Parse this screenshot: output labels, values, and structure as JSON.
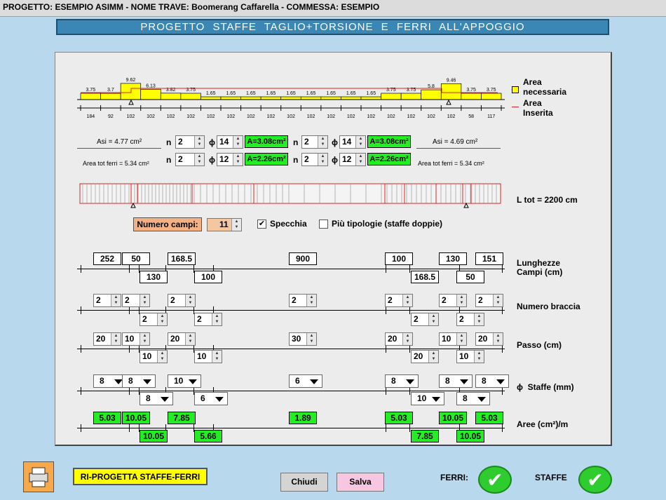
{
  "title": "PROGETTO: ESEMPIO ASIMM - NOME TRAVE: Boomerang Caffarella - COMMESSA: ESEMPIO",
  "banner": "PROGETTO   STAFFE   TAGLIO+TORSIONE   E   FERRI  ALL'APPOGGIO",
  "diagram": {
    "top_values": [
      "3.75",
      "3.7",
      "9.62",
      "6.13",
      "3.82",
      "3.75",
      "1.65",
      "1.65",
      "1.65",
      "1.65",
      "1.65",
      "1.65",
      "1.65",
      "1.65",
      "1.65",
      "3.75",
      "3.75",
      "5.8",
      "9.46",
      "3.75",
      "3.75"
    ],
    "bottom_values": [
      "184",
      "92",
      "102",
      "102",
      "102",
      "102",
      "102",
      "102",
      "102",
      "102",
      "102",
      "102",
      "102",
      "102",
      "102",
      "102",
      "102",
      "102",
      "102",
      "58",
      "117"
    ],
    "legend_area_nec": "Area necessaria",
    "legend_area_ins": "Area Inserita"
  },
  "rebar": {
    "asi_left": "Asi =  4.77 cm²",
    "asi_right": "Asi =  4.69 cm²",
    "tot_left": "Area tot ferri = 5.34 cm²",
    "tot_right": "Area tot ferri = 5.34 cm²",
    "n_label": "n",
    "phi": "ϕ",
    "row1": {
      "n1": "2",
      "d1": "14",
      "a1": "A=3.08cm²",
      "n2": "2",
      "d2": "14",
      "a2": "A=3.08cm²"
    },
    "row2": {
      "n1": "2",
      "d1": "12",
      "a1": "A=2.26cm²",
      "n2": "2",
      "d2": "12",
      "a2": "A=2.26cm²"
    }
  },
  "ltot": "L tot =  2200 cm",
  "numero_campi_label": "Numero campi:",
  "numero_campi": "11",
  "specchia": "Specchia",
  "specchia_mark": "✔",
  "piu_tipologie": "Più tipologie (staffe doppie)",
  "lunghezze": {
    "label": "Lunghezze Campi (cm)",
    "top": [
      "252",
      "50",
      "168.5",
      "900",
      "100",
      "130",
      "151"
    ],
    "bottom": [
      "130",
      "100",
      "168.5",
      "50"
    ]
  },
  "braccia": {
    "label": "Numero braccia",
    "top": [
      "2",
      "2",
      "2",
      "2",
      "2",
      "2",
      "2"
    ],
    "bottom": [
      "2",
      "2",
      "2",
      "2"
    ]
  },
  "passo": {
    "label": "Passo  (cm)",
    "top": [
      "20",
      "10",
      "20",
      "30",
      "20",
      "10",
      "20"
    ],
    "bottom": [
      "10",
      "10",
      "20",
      "10"
    ]
  },
  "staffe": {
    "label": "Staffe  (mm)",
    "top": [
      "8",
      "8",
      "10",
      "6",
      "8",
      "8",
      "8"
    ],
    "bottom": [
      "8",
      "6",
      "10",
      "8"
    ]
  },
  "aree": {
    "label": "Aree  (cm²)/m",
    "top": [
      "5.03",
      "10.05",
      "7.85",
      "1.89",
      "5.03",
      "10.05",
      "5.03"
    ],
    "bottom": [
      "10.05",
      "5.66",
      "7.85",
      "10.05"
    ]
  },
  "buttons": {
    "riprogetta": "RI-PROGETTA  STAFFE-FERRI",
    "chiudi": "Chiudi",
    "salva": "Salva"
  },
  "status": {
    "ferri": "FERRI:",
    "staffe": "STAFFE",
    "ok_mark": "✔"
  },
  "colors": {
    "banner": "#3a87b6",
    "bar_fill": "#ffff00",
    "inserted_line": "#e02020",
    "green": "#22ee22",
    "ok": "#2ecc2e"
  }
}
